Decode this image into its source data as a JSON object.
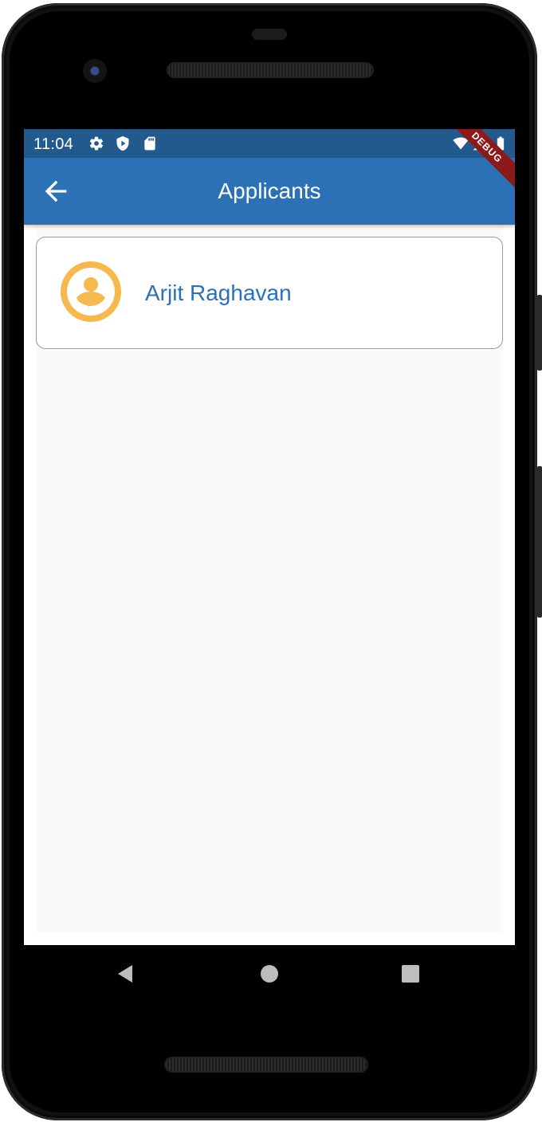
{
  "status_bar": {
    "time": "11:04",
    "left_icons": [
      "gear-icon",
      "shield-play-icon",
      "sd-card-icon"
    ],
    "right_icons": [
      "wifi-icon",
      "cell-signal-icon",
      "battery-icon"
    ]
  },
  "debug_banner": {
    "label": "DEBUG"
  },
  "app_bar": {
    "title": "Applicants",
    "back_icon": "arrow-back-icon"
  },
  "applicants": [
    {
      "name": "Arjit Raghavan",
      "avatar_icon": "person-pin-icon"
    }
  ],
  "nav_bar": {
    "buttons": [
      "back-triangle-icon",
      "home-circle-icon",
      "recents-square-icon"
    ]
  },
  "colors": {
    "status_bar": "#235a8e",
    "app_bar": "#2c71b5",
    "accent_text": "#2c71b5",
    "avatar": "#f5b94e",
    "debug_banner": "#8b1a1a",
    "content_bg": "#fafafa"
  }
}
